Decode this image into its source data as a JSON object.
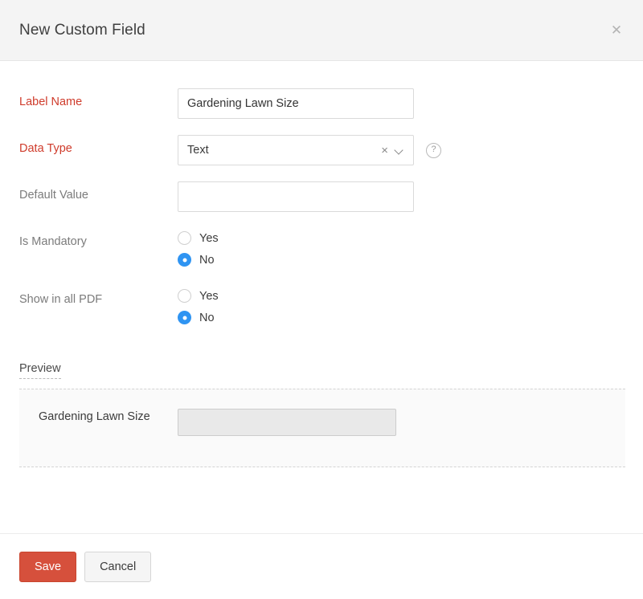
{
  "dialog": {
    "title": "New Custom Field",
    "close_icon": "close-icon"
  },
  "form": {
    "label_name": {
      "label": "Label Name",
      "value": "Gardening Lawn Size",
      "placeholder": ""
    },
    "data_type": {
      "label": "Data Type",
      "value": "Text",
      "clear_icon": "×",
      "caret_icon": "chevron-down-icon",
      "help_icon": "?"
    },
    "default_value": {
      "label": "Default Value",
      "value": "",
      "placeholder": ""
    },
    "is_mandatory": {
      "label": "Is Mandatory",
      "options": [
        {
          "label": "Yes",
          "selected": false
        },
        {
          "label": "No",
          "selected": true
        }
      ]
    },
    "show_in_all_pdf": {
      "label": "Show in all PDF",
      "options": [
        {
          "label": "Yes",
          "selected": false
        },
        {
          "label": "No",
          "selected": true
        }
      ]
    }
  },
  "preview": {
    "title": "Preview",
    "field_label": "Gardening Lawn Size",
    "field_value": ""
  },
  "footer": {
    "save_label": "Save",
    "cancel_label": "Cancel"
  },
  "colors": {
    "accent_red": "#d6503c",
    "required_label": "#cf3b2b",
    "radio_selected": "#2f94f2",
    "header_bg": "#f4f4f4"
  }
}
